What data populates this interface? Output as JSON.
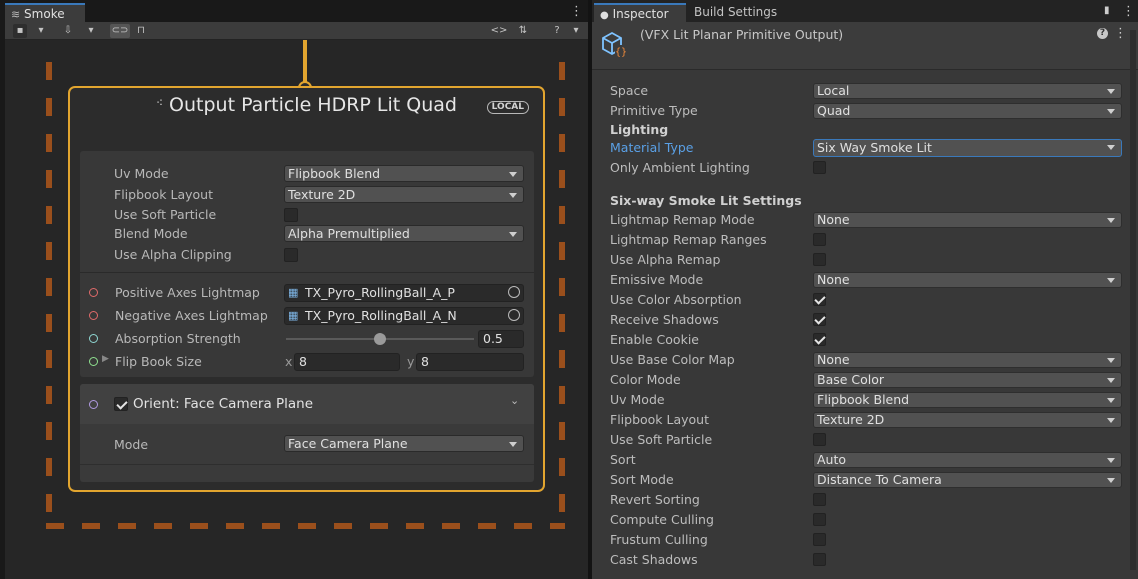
{
  "left_panel": {
    "tab_title": "Smoke",
    "node": {
      "title": "Output Particle HDRP Lit Quad",
      "badge": "LOCAL",
      "props": [
        {
          "label": "Uv Mode",
          "value": "Flipbook Blend"
        },
        {
          "label": "Flipbook Layout",
          "value": "Texture 2D"
        },
        {
          "label": "Use Soft Particle"
        },
        {
          "label": "Blend Mode",
          "value": "Alpha Premultiplied"
        },
        {
          "label": "Use Alpha Clipping"
        }
      ],
      "inputs": {
        "positive_label": "Positive Axes Lightmap",
        "positive_value": "TX_Pyro_RollingBall_A_P",
        "negative_label": "Negative Axes Lightmap",
        "negative_value": "TX_Pyro_RollingBall_A_N",
        "absorption_label": "Absorption Strength",
        "absorption_value": "0.5",
        "absorption_slider": 0.5,
        "flipbook_label": "Flip Book Size",
        "x_label": "x",
        "x_value": "8",
        "y_label": "y",
        "y_value": "8"
      },
      "block": {
        "title": "Orient: Face Camera Plane",
        "enabled": true,
        "mode_label": "Mode",
        "mode_value": "Face Camera Plane"
      }
    }
  },
  "right_panel": {
    "tabs": [
      "Inspector",
      "Build Settings"
    ],
    "component_title": "(VFX Lit Planar Primitive Output)",
    "section_lighting": "Lighting",
    "section_sixway": "Six-way Smoke Lit Settings",
    "rows_top": [
      {
        "label": "Space",
        "value": "Local"
      },
      {
        "label": "Primitive Type",
        "value": "Quad"
      }
    ],
    "material_type": {
      "label": "Material Type",
      "value": "Six Way Smoke Lit"
    },
    "only_ambient": {
      "label": "Only Ambient Lighting",
      "checked": false
    },
    "rows_sixway": [
      {
        "label": "Lightmap Remap Mode",
        "value": "None"
      },
      {
        "label": "Lightmap Remap Ranges",
        "checked": false
      },
      {
        "label": "Use Alpha Remap",
        "checked": false
      },
      {
        "label": "Emissive Mode",
        "value": "None"
      },
      {
        "label": "Use Color Absorption",
        "checked": true
      },
      {
        "label": "Receive Shadows",
        "checked": true
      },
      {
        "label": "Enable Cookie",
        "checked": true
      },
      {
        "label": "Use Base Color Map",
        "value": "None"
      },
      {
        "label": "Color Mode",
        "value": "Base Color"
      },
      {
        "label": "Uv Mode",
        "value": "Flipbook Blend"
      },
      {
        "label": "Flipbook Layout",
        "value": "Texture 2D"
      },
      {
        "label": "Use Soft Particle",
        "checked": false
      },
      {
        "label": "Sort",
        "value": "Auto"
      },
      {
        "label": "Sort Mode",
        "value": "Distance To Camera"
      },
      {
        "label": "Revert Sorting",
        "checked": false
      },
      {
        "label": "Compute Culling",
        "checked": false
      },
      {
        "label": "Frustum Culling",
        "checked": false
      },
      {
        "label": "Cast Shadows",
        "checked": false
      }
    ]
  },
  "colors": {
    "node_border": "#e2a52f",
    "dashed_border": "#9a4f1c",
    "accent_blue": "#3a79bb",
    "highlight_label": "#5aa0e6"
  }
}
